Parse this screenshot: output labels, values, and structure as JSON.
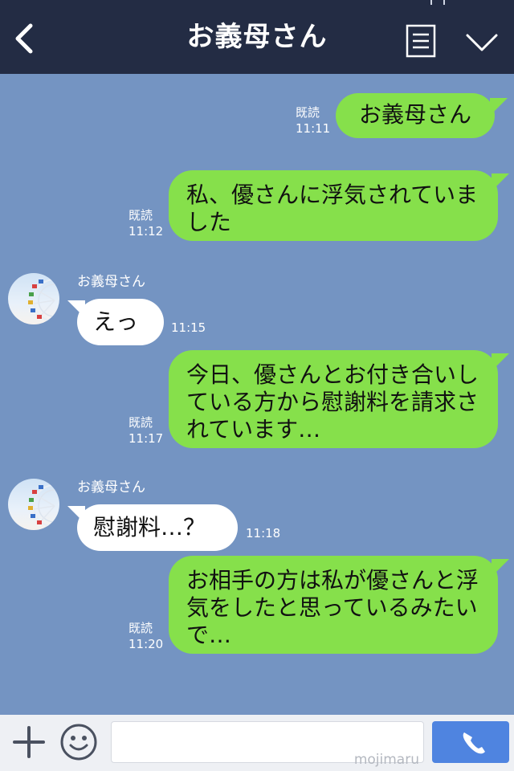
{
  "header": {
    "title": "お義母さん",
    "back_icon": "chevron-left-icon",
    "menu_icon": "notes-icon",
    "dropdown_icon": "chevron-down-icon"
  },
  "messages": [
    {
      "direction": "out",
      "read_label": "既読",
      "time": "11:11",
      "text": "お義母さん"
    },
    {
      "direction": "out",
      "read_label": "既読",
      "time": "11:12",
      "text": "私、優さんに浮気されていました"
    },
    {
      "direction": "in",
      "sender": "お義母さん",
      "time": "11:15",
      "text": "えっ"
    },
    {
      "direction": "out",
      "read_label": "既読",
      "time": "11:17",
      "text": "今日、優さんとお付き合いしている方から慰謝料を請求されています…"
    },
    {
      "direction": "in",
      "sender": "お義母さん",
      "time": "11:18",
      "text": "慰謝料…？"
    },
    {
      "direction": "out",
      "read_label": "既読",
      "time": "11:20",
      "text": "お相手の方は私が優さんと浮気をしたと思っているみたいで…"
    }
  ],
  "footer": {
    "plus_icon": "plus-icon",
    "emoji_icon": "smiley-icon",
    "input_value": "",
    "watermark": "mojimaru",
    "call_icon": "phone-icon"
  },
  "colors": {
    "background": "#7494c2",
    "header": "#232c44",
    "outgoing_bubble": "#86e04b",
    "incoming_bubble": "#ffffff",
    "call_button": "#4f84e0"
  }
}
